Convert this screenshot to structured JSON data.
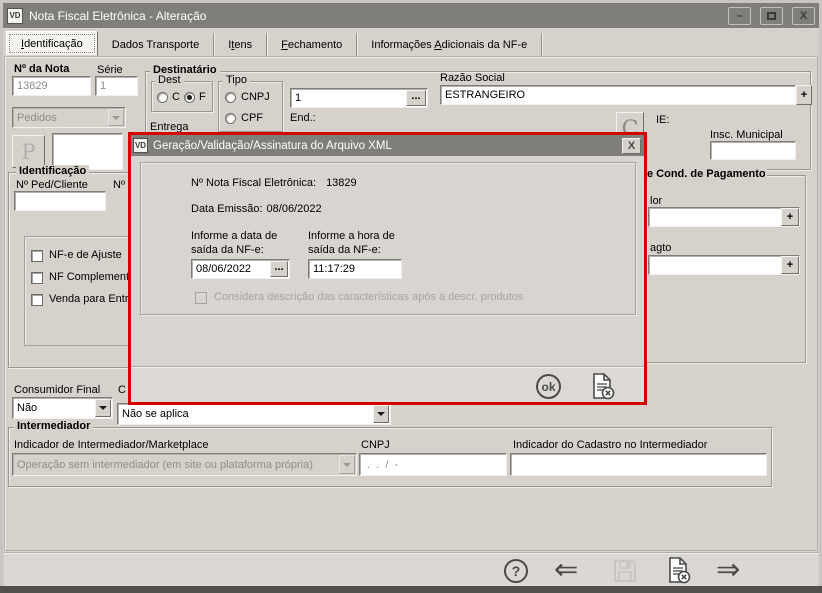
{
  "window": {
    "title": "Nota Fiscal Eletrônica - Alteração",
    "app_icon": "VD",
    "titlebar_color": "#807e79",
    "minimize_glyph": "–",
    "close_glyph": "X"
  },
  "tabs": [
    {
      "pre": "",
      "u": "I",
      "post": "dentificação"
    },
    {
      "pre": "Dados Transporte",
      "u": "",
      "post": ""
    },
    {
      "pre": "I",
      "u": "t",
      "post": "ens"
    },
    {
      "pre": "",
      "u": "F",
      "post": "echamento"
    },
    {
      "pre": "Informações ",
      "u": "A",
      "post": "dicionais da NF-e"
    }
  ],
  "nota": {
    "label": "Nº da Nota",
    "value": "13829"
  },
  "serie": {
    "label": "Série",
    "value": "1"
  },
  "pedidos_combo": {
    "value": "Pedidos"
  },
  "p_button_label": "P",
  "destinatario": {
    "title": "Destinatário",
    "dest_group": {
      "title": "Dest",
      "option_c": "C",
      "option_f": "F",
      "selected": "F"
    },
    "tipo_group": {
      "title": "Tipo",
      "option_cnpj": "CNPJ",
      "option_cpf": "CPF"
    },
    "codigo_value": "1",
    "browse_label": "...",
    "end_label": "End.:",
    "entrega_label": "Entrega",
    "razao_social": {
      "label": "Razão Social",
      "value": "ESTRANGEIRO",
      "add_label": "+"
    },
    "c_button_label": "C",
    "ie_label": "IE:",
    "insc_municipal_label": "Insc. Municipal"
  },
  "identificacao": {
    "title": "Identificação",
    "ped_cliente_label": "Nº Ped/Cliente",
    "truncated_label": "Nº",
    "checkboxes": [
      "NF-e de Ajuste",
      "NF Complement",
      "Venda para Entr"
    ]
  },
  "pagamento": {
    "title_fragment": "e Cond. de Pagamento",
    "label1_fragment": "lor",
    "label2_fragment": "agto",
    "add_label": "+"
  },
  "consumidor_final": {
    "label": "Consumidor Final",
    "value": "Não",
    "truncated_label": "C",
    "combo2_value": "Não se aplica"
  },
  "intermediador": {
    "title": "Intermediador",
    "indicador_label": "Indicador de Intermediador/Marketplace",
    "indicador_value": "Operação sem intermediador (em site ou plataforma própria)",
    "cnpj_label": "CNPJ",
    "cnpj_mask": " .  .  /  -",
    "cadastro_label": "Indicador do Cadastro no Intermediador"
  },
  "modal": {
    "app_icon": "VD",
    "title": "Geração/Validação/Assinatura do Arquivo XML",
    "close_glyph": "X",
    "border_color": "#d40000",
    "nfe_label": "Nº Nota Fiscal Eletrônica:",
    "nfe_value": "13829",
    "emissao_label": "Data Emissão:",
    "emissao_value": "08/06/2022",
    "data_label_line1": "Informe a data de",
    "data_label_line2": "saída da NF-e:",
    "hora_label_line1": "Informe a hora de",
    "hora_label_line2": "saída da NF-e:",
    "data_value": "08/06/2022",
    "browse_label": "...",
    "hora_value": "11:17:29",
    "checkbox_label": "Considera descrição das características após a descr. produtos",
    "ok_label": "ok"
  },
  "toolbar": {
    "help_glyph": "?",
    "back_glyph": "⇐",
    "forward_glyph": "⇒"
  }
}
